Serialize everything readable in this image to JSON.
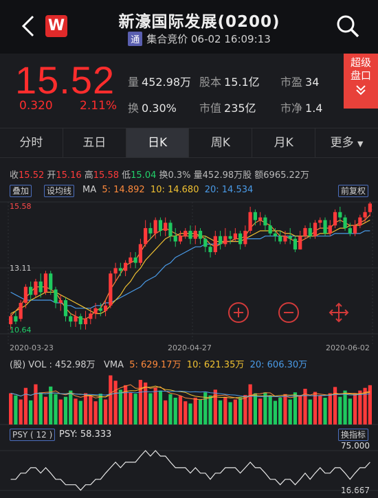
{
  "header": {
    "title": "新濠国际发展(0200)",
    "badge": "通",
    "status": "集合竞价 06-02 16:09:13",
    "logo": "W"
  },
  "quote": {
    "price": "15.52",
    "change": "0.320",
    "change_pct": "2.11%",
    "stats": [
      {
        "label": "量",
        "value": "452.98万"
      },
      {
        "label": "股本",
        "value": "15.1亿"
      },
      {
        "label": "市盈",
        "value": "34"
      },
      {
        "label": "换",
        "value": "0.30%"
      },
      {
        "label": "市值",
        "value": "235亿"
      },
      {
        "label": "市净",
        "value": "1.4"
      }
    ],
    "super_button": [
      "超级",
      "盘口"
    ]
  },
  "tabs": [
    "分时",
    "五日",
    "日K",
    "周K",
    "月K",
    "更多"
  ],
  "info": {
    "shou_label": "收",
    "shou": "15.52",
    "kai_label": "开",
    "kai": "15.16",
    "gao_label": "高",
    "gao": "15.58",
    "di_label": "低",
    "di": "15.04",
    "rest": "换0.3%  量452.98万股  额6965.22万"
  },
  "controls": {
    "overlay": "叠加",
    "set_ma": "设均线",
    "adjust": "前复权",
    "switch_indicator": "换指标"
  },
  "ma": {
    "label": "MA",
    "ma5": "5: 14.892",
    "ma10": "10: 14.680",
    "ma20": "20: 14.534"
  },
  "vol": {
    "label": "(股) VOL :  452.98万",
    "vma_label": "VMA",
    "vma5": "5: 629.17万",
    "vma10": "10: 621.35万",
    "vma20": "20: 606.30万"
  },
  "psy": {
    "tag": "PSY ( 12 )",
    "value": "PSY: 58.333",
    "top": "75.000",
    "bottom": "16.667"
  },
  "chart_data": {
    "type": "candlestick",
    "price_labels": [
      "15.58",
      "13.11",
      "10.64"
    ],
    "dates": [
      "2020-03-23",
      "2020-04-27",
      "2020-06-02"
    ],
    "ylim": [
      10.64,
      15.58
    ],
    "candles": [
      [
        11.0,
        11.3,
        10.8,
        11.4
      ],
      [
        11.3,
        11.1,
        11.0,
        11.5
      ],
      [
        11.2,
        11.8,
        11.1,
        11.9
      ],
      [
        11.8,
        12.4,
        11.6,
        12.5
      ],
      [
        12.4,
        12.1,
        11.9,
        12.6
      ],
      [
        12.1,
        12.6,
        12.0,
        12.7
      ],
      [
        12.6,
        12.2,
        12.0,
        12.9
      ],
      [
        12.2,
        12.9,
        12.1,
        13.0
      ],
      [
        12.9,
        12.3,
        12.1,
        13.0
      ],
      [
        12.3,
        11.8,
        11.6,
        12.4
      ],
      [
        11.8,
        11.9,
        11.5,
        12.1
      ],
      [
        11.9,
        11.3,
        11.1,
        12.0
      ],
      [
        11.3,
        11.1,
        10.9,
        11.4
      ],
      [
        11.1,
        11.3,
        10.9,
        11.5
      ],
      [
        11.3,
        11.0,
        10.8,
        11.4
      ],
      [
        11.0,
        11.2,
        10.8,
        11.5
      ],
      [
        11.2,
        11.4,
        11.0,
        11.6
      ],
      [
        11.4,
        11.6,
        11.2,
        11.8
      ],
      [
        11.6,
        11.5,
        11.3,
        11.8
      ],
      [
        11.5,
        11.7,
        11.3,
        11.9
      ],
      [
        11.7,
        12.9,
        11.6,
        13.0
      ],
      [
        12.9,
        13.1,
        12.6,
        13.3
      ],
      [
        13.1,
        13.0,
        12.8,
        13.3
      ],
      [
        13.0,
        13.3,
        12.8,
        13.4
      ],
      [
        13.3,
        13.5,
        13.1,
        13.7
      ],
      [
        13.5,
        13.3,
        13.1,
        13.7
      ],
      [
        13.3,
        14.0,
        13.2,
        14.2
      ],
      [
        14.0,
        14.6,
        13.9,
        14.9
      ],
      [
        14.6,
        14.4,
        14.2,
        14.8
      ],
      [
        14.4,
        14.9,
        14.2,
        15.0
      ],
      [
        14.9,
        14.5,
        14.3,
        15.0
      ],
      [
        14.5,
        14.8,
        14.3,
        15.0
      ],
      [
        14.8,
        14.3,
        14.1,
        14.9
      ],
      [
        14.3,
        14.1,
        13.9,
        14.6
      ],
      [
        14.1,
        14.3,
        14.0,
        14.5
      ],
      [
        14.3,
        14.5,
        14.2,
        14.6
      ],
      [
        14.5,
        14.2,
        14.0,
        14.7
      ],
      [
        14.2,
        14.5,
        14.0,
        14.7
      ],
      [
        14.5,
        14.2,
        14.0,
        14.6
      ],
      [
        14.2,
        13.9,
        13.7,
        14.3
      ],
      [
        13.9,
        13.7,
        13.5,
        14.0
      ],
      [
        13.7,
        14.3,
        13.6,
        14.5
      ],
      [
        14.3,
        14.0,
        13.8,
        14.5
      ],
      [
        14.0,
        14.3,
        13.9,
        14.6
      ],
      [
        14.3,
        14.2,
        14.0,
        14.5
      ],
      [
        14.2,
        14.4,
        14.1,
        14.6
      ],
      [
        14.4,
        14.0,
        13.8,
        14.5
      ],
      [
        14.0,
        14.5,
        13.9,
        14.7
      ],
      [
        14.5,
        15.2,
        14.4,
        15.4
      ],
      [
        15.2,
        14.9,
        14.7,
        15.3
      ],
      [
        14.9,
        15.0,
        14.7,
        15.2
      ],
      [
        15.0,
        14.7,
        14.5,
        15.1
      ],
      [
        14.7,
        14.4,
        14.3,
        14.9
      ],
      [
        14.4,
        14.3,
        14.1,
        14.6
      ],
      [
        14.3,
        14.1,
        14.0,
        14.5
      ],
      [
        14.1,
        14.3,
        14.0,
        14.5
      ],
      [
        14.3,
        14.2,
        14.0,
        14.6
      ],
      [
        14.2,
        13.8,
        13.7,
        14.3
      ],
      [
        13.8,
        14.3,
        13.8,
        14.5
      ],
      [
        14.3,
        14.6,
        14.2,
        14.7
      ],
      [
        14.6,
        14.3,
        14.2,
        14.8
      ],
      [
        14.3,
        14.8,
        14.2,
        14.9
      ],
      [
        14.8,
        14.9,
        14.6,
        15.0
      ],
      [
        14.9,
        14.4,
        14.3,
        15.0
      ],
      [
        14.4,
        14.7,
        14.3,
        14.9
      ],
      [
        14.7,
        15.2,
        14.6,
        15.3
      ],
      [
        15.2,
        15.0,
        14.8,
        15.4
      ],
      [
        15.0,
        14.6,
        14.5,
        15.1
      ],
      [
        14.6,
        14.4,
        14.3,
        14.8
      ],
      [
        14.4,
        14.7,
        14.3,
        14.9
      ],
      [
        14.7,
        15.0,
        14.6,
        15.1
      ],
      [
        15.0,
        15.2,
        14.8,
        15.4
      ],
      [
        15.2,
        15.52,
        15.04,
        15.58
      ]
    ],
    "ma5": [
      11.3,
      11.5,
      11.7,
      12.0,
      12.2,
      12.4,
      12.4,
      12.4,
      12.3,
      12.2,
      11.9,
      11.6,
      11.4,
      11.3,
      11.2,
      11.2,
      11.3,
      11.5,
      11.6,
      11.9,
      12.3,
      12.6,
      12.9,
      13.2,
      13.3,
      13.4,
      13.7,
      14.0,
      14.2,
      14.4,
      14.5,
      14.6,
      14.5,
      14.4,
      14.3,
      14.3,
      14.3,
      14.3,
      14.3,
      14.2,
      14.0,
      13.9,
      14.0,
      14.1,
      14.1,
      14.2,
      14.2,
      14.3,
      14.6,
      14.8,
      14.9,
      14.8,
      14.7,
      14.5,
      14.3,
      14.3,
      14.2,
      14.1,
      14.1,
      14.2,
      14.3,
      14.5,
      14.6,
      14.6,
      14.6,
      14.8,
      14.9,
      14.8,
      14.7,
      14.7,
      14.8,
      14.9,
      15.1
    ],
    "ma10": [
      11.4,
      11.5,
      11.6,
      11.7,
      11.9,
      12.0,
      12.1,
      12.2,
      12.2,
      12.2,
      12.1,
      12.0,
      11.9,
      11.8,
      11.7,
      11.6,
      11.5,
      11.4,
      11.4,
      11.5,
      11.7,
      11.9,
      12.1,
      12.4,
      12.6,
      12.9,
      13.1,
      13.4,
      13.6,
      13.8,
      14.0,
      14.2,
      14.3,
      14.3,
      14.4,
      14.4,
      14.4,
      14.4,
      14.3,
      14.3,
      14.2,
      14.1,
      14.1,
      14.1,
      14.1,
      14.1,
      14.1,
      14.2,
      14.3,
      14.4,
      14.5,
      14.5,
      14.5,
      14.5,
      14.5,
      14.4,
      14.4,
      14.3,
      14.3,
      14.3,
      14.3,
      14.3,
      14.4,
      14.4,
      14.4,
      14.5,
      14.6,
      14.6,
      14.7,
      14.7,
      14.7,
      14.8,
      14.9
    ],
    "ma20": [
      12.2,
      12.1,
      12.0,
      11.9,
      11.9,
      11.9,
      11.9,
      11.9,
      11.9,
      11.8,
      11.8,
      11.7,
      11.7,
      11.6,
      11.6,
      11.6,
      11.6,
      11.7,
      11.7,
      11.8,
      11.8,
      11.9,
      12.0,
      12.1,
      12.2,
      12.3,
      12.4,
      12.6,
      12.7,
      12.8,
      13.0,
      13.2,
      13.3,
      13.5,
      13.6,
      13.7,
      13.8,
      13.9,
      13.9,
      14.0,
      14.0,
      14.0,
      14.0,
      14.1,
      14.1,
      14.1,
      14.1,
      14.2,
      14.2,
      14.2,
      14.2,
      14.3,
      14.3,
      14.3,
      14.3,
      14.3,
      14.3,
      14.3,
      14.3,
      14.3,
      14.3,
      14.3,
      14.3,
      14.3,
      14.3,
      14.4,
      14.4,
      14.4,
      14.4,
      14.4,
      14.4,
      14.5,
      14.5
    ],
    "volume_max": 1200,
    "volumes": [
      700,
      650,
      560,
      820,
      540,
      900,
      720,
      620,
      850,
      680,
      560,
      620,
      760,
      580,
      530,
      700,
      640,
      520,
      690,
      560,
      1100,
      980,
      780,
      880,
      720,
      690,
      1000,
      940,
      700,
      820,
      760,
      540,
      680,
      600,
      640,
      520,
      470,
      600,
      560,
      720,
      650,
      780,
      540,
      620,
      500,
      560,
      600,
      660,
      900,
      700,
      580,
      720,
      640,
      530,
      600,
      680,
      560,
      720,
      660,
      800,
      560,
      730,
      650,
      600,
      700,
      840,
      620,
      760,
      580,
      690,
      760,
      820,
      880
    ],
    "psy_values": [
      33,
      33,
      42,
      42,
      50,
      50,
      42,
      50,
      42,
      33,
      33,
      25,
      25,
      25,
      17,
      25,
      25,
      33,
      33,
      42,
      50,
      58,
      50,
      58,
      58,
      58,
      67,
      75,
      67,
      75,
      67,
      67,
      58,
      50,
      50,
      50,
      42,
      50,
      42,
      42,
      33,
      42,
      42,
      50,
      50,
      50,
      42,
      50,
      58,
      50,
      50,
      42,
      33,
      33,
      25,
      33,
      33,
      25,
      33,
      42,
      33,
      42,
      50,
      42,
      42,
      50,
      50,
      42,
      33,
      42,
      50,
      50,
      58
    ],
    "psy_ylim": [
      16.667,
      75.0
    ]
  }
}
